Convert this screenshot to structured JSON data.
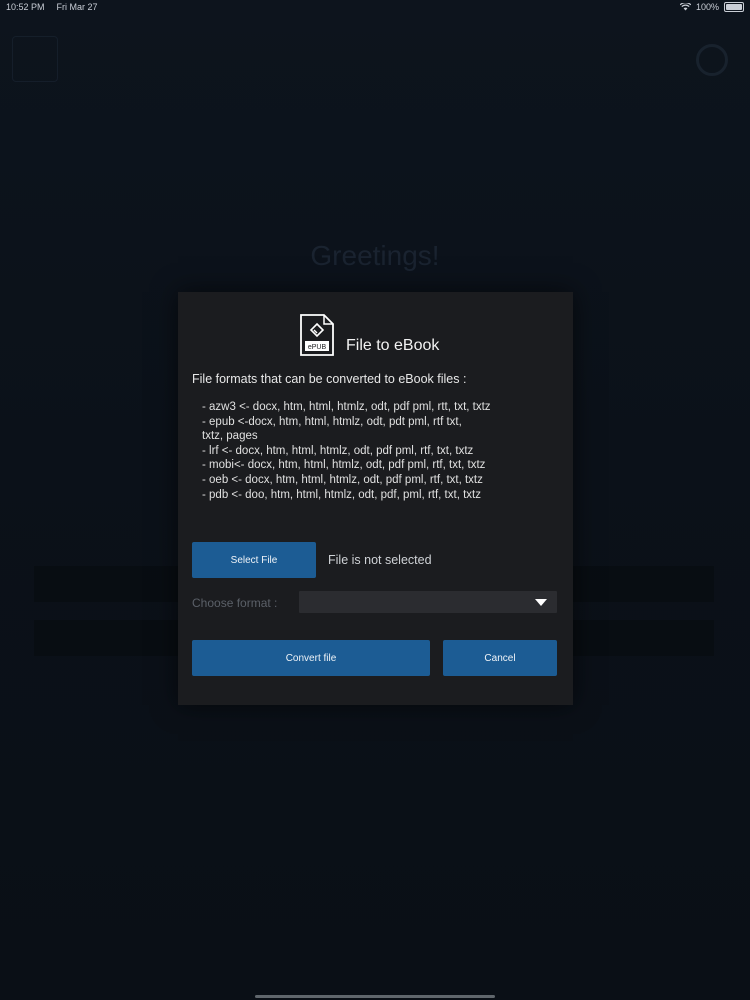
{
  "status_bar": {
    "time": "10:52 PM",
    "date": "Fri Mar 27",
    "battery": "100%"
  },
  "background": {
    "greeting": "Greetings!"
  },
  "dialog": {
    "title": "File to eBook",
    "icon_label": "ePUB",
    "intro": "File formats that can be converted to eBook files :",
    "formats": [
      "- azw3 <- docx, htm, html, htmlz, odt, pdf pml, rtt, txt, txtz",
      "- epub <-docx, htm, html, htmlz, odt, pdt pml, rtf txt,",
      "txtz, pages",
      "- lrf <- docx, htm, html, htmlz, odt, pdf pml, rtf, txt, txtz",
      "- mobi<- docx, htm, html, htmlz, odt, pdf pml, rtf, txt, txtz",
      "- oeb <- docx, htm, html, htmlz, odt, pdf pml, rtf, txt, txtz",
      "- pdb <- doo, htm, html, htmlz, odt, pdf, pml, rtf, txt, txtz"
    ],
    "select_file_label": "Select File",
    "file_status": "File is not selected",
    "choose_format_label": "Choose format :",
    "format_value": "",
    "convert_label": "Convert file",
    "cancel_label": "Cancel"
  },
  "colors": {
    "button": "#1c5c94",
    "dialog_bg": "#1b1c1f",
    "page_bg": "#0d141d"
  }
}
